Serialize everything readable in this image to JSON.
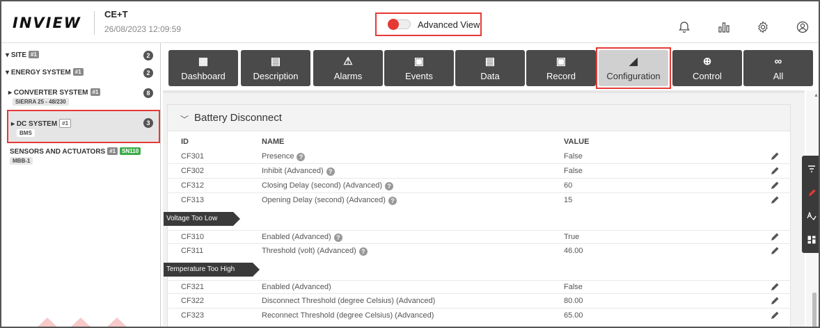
{
  "header": {
    "logo": "INVIEW",
    "site_name": "CE+T",
    "datetime": "26/08/2023 12:09:59",
    "advanced_view_label": "Advanced View",
    "advanced_view_on": true,
    "icons": [
      "bell-icon",
      "bar-chart-icon",
      "gear-icon",
      "user-icon"
    ]
  },
  "sidebar": {
    "site": {
      "label": "SITE",
      "tag": "#1",
      "count": "2"
    },
    "energy": {
      "label": "ENERGY SYSTEM",
      "tag": "#1",
      "count": "2"
    },
    "converter": {
      "label": "CONVERTER SYSTEM",
      "tag": "#1",
      "sub": "SIERRA 25 - 48/230",
      "count": "8"
    },
    "dc": {
      "label": "DC SYSTEM",
      "tag": "#1",
      "sub": "BMS",
      "count": "3"
    },
    "sensors": {
      "label": "SENSORS AND ACTUATORS",
      "tag": "#1",
      "tag2": "SN110",
      "sub": "MBB-1"
    }
  },
  "tabs": [
    {
      "label": "Dashboard",
      "icon": "dashboard-icon",
      "glyph": "▦"
    },
    {
      "label": "Description",
      "icon": "document-icon",
      "glyph": "▤"
    },
    {
      "label": "Alarms",
      "icon": "alarm-icon",
      "glyph": "⚠"
    },
    {
      "label": "Events",
      "icon": "calendar-icon",
      "glyph": "▣"
    },
    {
      "label": "Data",
      "icon": "data-icon",
      "glyph": "▤"
    },
    {
      "label": "Record",
      "icon": "record-icon",
      "glyph": "▣"
    },
    {
      "label": "Configuration",
      "icon": "configuration-icon",
      "glyph": "◢"
    },
    {
      "label": "Control",
      "icon": "control-icon",
      "glyph": "⊕"
    },
    {
      "label": "All",
      "icon": "infinity-icon",
      "glyph": "∞"
    }
  ],
  "active_tab": "Configuration",
  "panel": {
    "title": "Battery Disconnect",
    "columns": {
      "id": "ID",
      "name": "NAME",
      "value": "VALUE"
    },
    "rows": [
      {
        "id": "CF301",
        "name": "Presence",
        "help": true,
        "value": "False"
      },
      {
        "id": "CF302",
        "name": "Inhibit (Advanced)",
        "help": true,
        "value": "False"
      },
      {
        "id": "CF312",
        "name": "Closing Delay (second) (Advanced)",
        "help": true,
        "value": "60"
      },
      {
        "id": "CF313",
        "name": "Opening Delay (second) (Advanced)",
        "help": true,
        "value": "15"
      }
    ],
    "groups": [
      {
        "label": "Voltage Too Low",
        "rows": [
          {
            "id": "CF310",
            "name": "Enabled (Advanced)",
            "help": true,
            "value": "True"
          },
          {
            "id": "CF311",
            "name": "Threshold (volt) (Advanced)",
            "help": true,
            "value": "46.00"
          }
        ]
      },
      {
        "label": "Temperature Too High",
        "rows": [
          {
            "id": "CF321",
            "name": "Enabled (Advanced)",
            "help": false,
            "value": "False"
          },
          {
            "id": "CF322",
            "name": "Disconnect Threshold (degree Celsius) (Advanced)",
            "help": false,
            "value": "80.00"
          },
          {
            "id": "CF323",
            "name": "Reconnect Threshold (degree Celsius) (Advanced)",
            "help": false,
            "value": "65.00"
          }
        ]
      }
    ]
  },
  "tool_rail": [
    "filter-icon",
    "pencil-icon",
    "spellcheck-icon",
    "grid-icon"
  ],
  "colors": {
    "accent_red": "#e53935",
    "tab_dark": "#4a4a4a",
    "tab_active": "#d0d0d0",
    "tag_green": "#3dab4a"
  }
}
